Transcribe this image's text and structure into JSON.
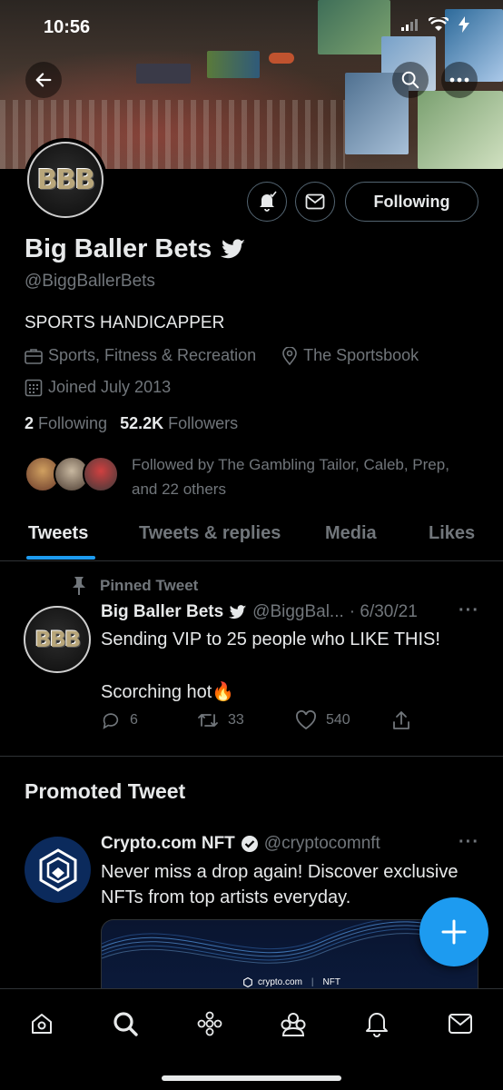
{
  "status_bar": {
    "time": "10:56"
  },
  "profile": {
    "name": "Big Baller Bets",
    "handle": "@BiggBallerBets",
    "avatar_text": "BBB",
    "bio": "SPORTS HANDICAPPER",
    "category": "Sports, Fitness & Recreation",
    "location": "The Sportsbook",
    "joined": "Joined July 2013",
    "following_count": "2",
    "following_label": "Following",
    "followers_count": "52.2K",
    "followers_label": "Followers",
    "followed_by": "Followed by The Gambling Tailor, Caleb, Prep, and 22 others",
    "follow_button": "Following"
  },
  "tabs": [
    "Tweets",
    "Tweets & replies",
    "Media",
    "Likes"
  ],
  "active_tab": "Tweets",
  "pinned_tweet": {
    "pinned_label": "Pinned Tweet",
    "author": "Big Baller Bets",
    "handle": "@BiggBal...",
    "date": "· 6/30/21",
    "line1": "Sending VIP to 25 people who LIKE THIS!",
    "line2": "Scorching hot🔥",
    "replies": "6",
    "retweets": "33",
    "likes": "540"
  },
  "promoted": {
    "section_title": "Promoted Tweet",
    "author": "Crypto.com NFT",
    "handle": "@cryptocomnft",
    "text": "Never miss a drop again! Discover exclusive NFTs from top artists everyday.",
    "card_brand": "crypto.com",
    "card_tag": "NFT"
  },
  "nav": [
    "home-icon",
    "search-icon",
    "spaces-icon",
    "communities-icon",
    "notifications-icon",
    "messages-icon"
  ],
  "colors": {
    "accent": "#1d9bf0",
    "background": "#000000",
    "muted": "#71767b",
    "text": "#e7e9ea"
  }
}
